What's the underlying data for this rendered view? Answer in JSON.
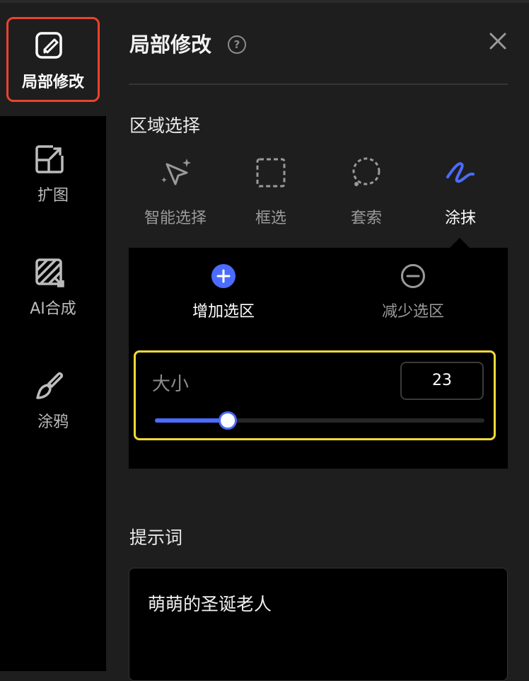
{
  "sidebar": {
    "items": [
      {
        "label": "局部修改",
        "icon": "edit-square-icon",
        "active": true
      },
      {
        "label": "扩图",
        "icon": "expand-image-icon"
      },
      {
        "label": "AI合成",
        "icon": "ai-compose-icon"
      },
      {
        "label": "涂鸦",
        "icon": "brush-icon"
      }
    ]
  },
  "panel": {
    "title": "局部修改",
    "help_icon": "question-circle-icon",
    "close_icon": "close-icon",
    "region_section": "区域选择",
    "tools": [
      {
        "label": "智能选择",
        "icon": "smart-select-icon"
      },
      {
        "label": "框选",
        "icon": "rect-select-icon"
      },
      {
        "label": "套索",
        "icon": "lasso-icon"
      },
      {
        "label": "涂抹",
        "icon": "smear-icon",
        "active": true
      }
    ],
    "modes": [
      {
        "label": "增加选区",
        "icon": "plus-circle-icon",
        "active": true
      },
      {
        "label": "减少选区",
        "icon": "minus-circle-icon"
      }
    ],
    "brush_size": {
      "label": "大小",
      "value": "23",
      "slider_fraction": 0.22
    },
    "prompt_section": "提示词",
    "prompt_value": "萌萌的圣诞老人"
  },
  "colors": {
    "accent": "#4c6bff",
    "active_outline": "#e8432d",
    "highlight_outline": "#f2d938",
    "background": "#1e1e1e"
  }
}
